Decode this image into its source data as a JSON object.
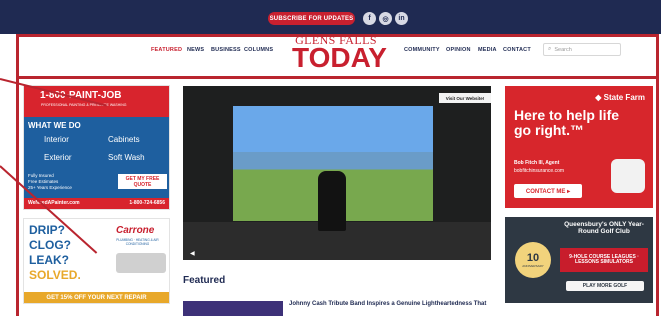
{
  "topbar": {
    "subscribe_label": "SUBSCRIBE FOR UPDATES",
    "social": [
      "f",
      "◎",
      "in"
    ]
  },
  "brand": {
    "top": "GLENS FALLS",
    "main": "TODAY"
  },
  "nav": {
    "left": [
      "FEATURED",
      "NEWS",
      "BUSINESS",
      "COLUMNS"
    ],
    "right": [
      "COMMUNITY",
      "OPINION",
      "MEDIA",
      "CONTACT"
    ]
  },
  "search": {
    "placeholder": "Search"
  },
  "ads": {
    "left1": {
      "phone": "1-800-PAINT-JOB",
      "tagline": "PROFESSIONAL PAINTING & PRESSURE WASHING",
      "what_we_do": "WHAT WE DO",
      "interior": "Interior",
      "cabinets": "Cabinets",
      "exterior": "Exterior",
      "soft_wash": "Soft Wash",
      "bullets": [
        "Fully Insured",
        "Free Estimates",
        "25+ Years Experience"
      ],
      "cta": "GET MY FREE QUOTE",
      "website": "WeNeedAPainter.com",
      "phone2": "1-800-724-6856"
    },
    "left2": {
      "line1": "DRIP?",
      "line2": "CLOG?",
      "line3": "LEAK?",
      "line4": "SOLVED.",
      "brand": "Carrone",
      "brand_sub": "PLUMBING · HEATING & AIR CONDITIONING",
      "promo": "GET 15% OFF YOUR NEXT REPAIR"
    },
    "right1": {
      "brand": "State Farm",
      "headline": "Here to help life go right.™",
      "agent": "Bob Fitch III, Agent",
      "site": "bobfitchinsurance.com",
      "cta": "CONTACT ME ▸"
    },
    "right2": {
      "headline": "Queensbury's ONLY Year-Round Golf Club",
      "badge_number": "10",
      "badge_label": "ANNIVERSARY",
      "features": "9-HOLE COURSE LEAGUES · LESSONS SIMULATORS",
      "cta": "PLAY MORE GOLF"
    }
  },
  "video": {
    "visit_label": "Visit Our Website!",
    "audio_icon": "speaker-icon"
  },
  "featured": {
    "label": "Featured",
    "headline": "Johnny Cash Tribute Band Inspires a Genuine Lightheartedness That"
  },
  "colors": {
    "navy": "#1f2a52",
    "red": "#c8202f",
    "dark_red": "#b9252f"
  }
}
